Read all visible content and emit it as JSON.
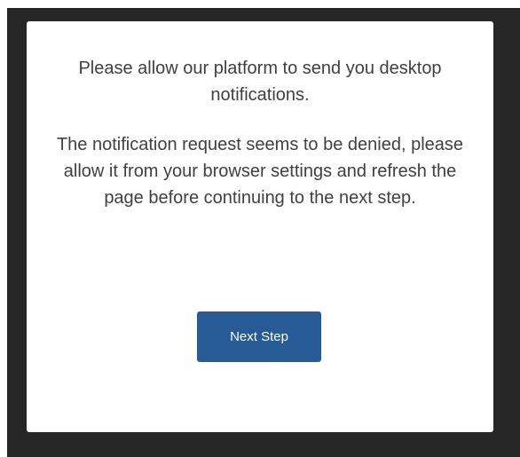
{
  "dialog": {
    "primary_message": "Please allow our platform to send you desktop notifications.",
    "secondary_message": "The notification request seems to be denied, please allow it from your browser settings and refresh the page before continuing to the next step.",
    "next_button_label": "Next Step"
  },
  "colors": {
    "backdrop": "#262626",
    "dialog_background": "#ffffff",
    "text": "#404040",
    "button_background": "#265b96",
    "button_text": "#ffffff"
  }
}
